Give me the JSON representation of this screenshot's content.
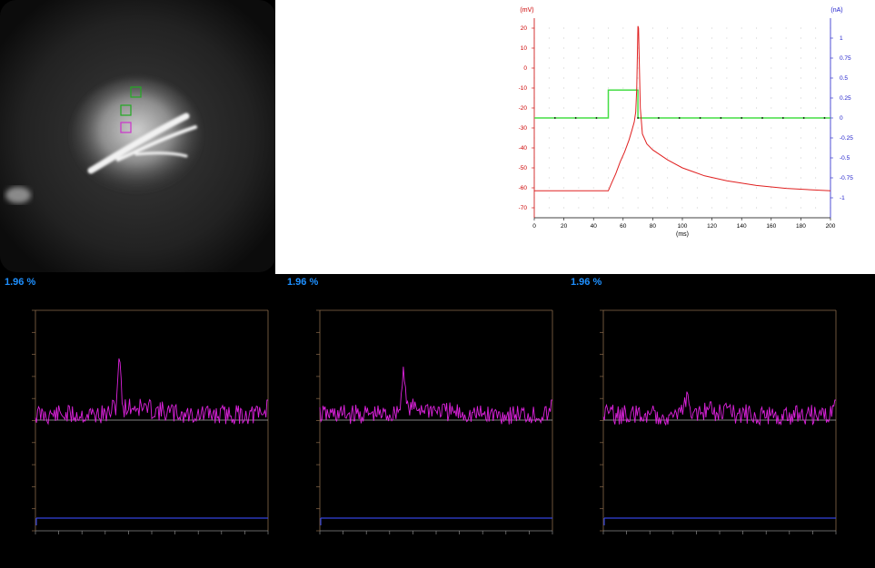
{
  "ephys_chart": {
    "type": "line",
    "ylabel_left": "(mV)",
    "ylabel_right": "(nA)",
    "xlabel": "(ms)",
    "x_ticks": [
      0,
      20,
      40,
      60,
      80,
      100,
      120,
      140,
      160,
      180,
      200
    ],
    "y_left_ticks": [
      20,
      10,
      0,
      -10,
      -20,
      -30,
      -40,
      -50,
      -60,
      -70
    ],
    "y_right_ticks": [
      "1",
      "0.75",
      "0.5",
      "0.25",
      "0",
      "-0.25",
      "-0.5",
      "-0.75",
      "-1"
    ],
    "xlim": [
      0,
      200
    ],
    "ylim_left": [
      -75,
      25
    ],
    "ylim_right": [
      -1.25,
      1.25
    ],
    "colors": {
      "voltage": "#e02020",
      "current": "#44dd44",
      "left_axis": "#cc0000",
      "right_axis": "#2222cc"
    }
  },
  "chart_data": [
    {
      "type": "line",
      "xlabel": "(ms)",
      "ylabel": "(mV)",
      "xlim": [
        0,
        200
      ],
      "ylim": [
        -75,
        25
      ],
      "x": [
        0,
        49,
        50,
        52,
        55,
        58,
        61,
        64,
        66,
        67.5,
        68.5,
        69.2,
        70,
        70.4,
        71,
        71.6,
        73,
        76,
        80,
        90,
        100,
        115,
        130,
        150,
        170,
        200
      ],
      "series": [
        {
          "values": [
            -61.5,
            -61.5,
            -61.5,
            -58,
            -53,
            -47,
            -42,
            -36,
            -31,
            -27,
            -22,
            -10,
            21,
            20,
            0,
            -20,
            -33,
            -38,
            -41,
            -46,
            -50,
            -54,
            -56.5,
            -58.8,
            -60.3,
            -61.5
          ]
        }
      ]
    },
    {
      "type": "line",
      "xlabel": "(ms)",
      "ylabel": "(nA)",
      "xlim": [
        0,
        200
      ],
      "ylim": [
        -1.25,
        1.25
      ],
      "x": [
        0,
        50,
        50,
        70,
        70,
        200
      ],
      "series": [
        {
          "values": [
            0,
            0,
            0.35,
            0.35,
            0,
            0
          ]
        }
      ]
    }
  ],
  "optical_panels": [
    {
      "label": "1.96 %",
      "peak_at": 0.36,
      "peak_height": 0.85,
      "color": "#dd22dd"
    },
    {
      "label": "1.96 %",
      "peak_at": 0.36,
      "peak_height": 0.7,
      "color": "#dd22dd"
    },
    {
      "label": "1.96 %",
      "peak_at": 0.36,
      "peak_height": 0.3,
      "color": "#dd22dd"
    }
  ],
  "roi_colors": [
    "#22aa22",
    "#22aa22",
    "#cc33cc"
  ]
}
